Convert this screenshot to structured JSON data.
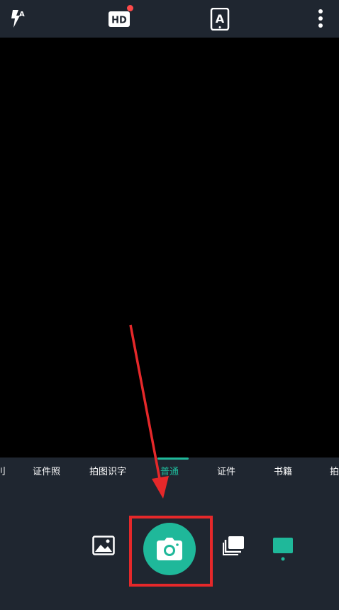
{
  "toolbar": {
    "icons": [
      "flash-auto-icon",
      "hd-icon",
      "text-recognition-icon",
      "more-icon"
    ],
    "hd_label": "HD",
    "ocr_label": "A",
    "flash_label": "A"
  },
  "modes": {
    "items": [
      "刂",
      "证件照",
      "拍图识字",
      "普通",
      "证件",
      "书籍",
      "拍"
    ],
    "selected": "普通"
  },
  "colors": {
    "accent": "#1fb89a",
    "annotation_red": "#e5282a",
    "badge_red": "#ff4a4a",
    "background": "#1f2630"
  },
  "controls": {
    "icons": [
      "gallery-icon",
      "camera-icon",
      "multi-page-icon",
      "tablet-icon"
    ]
  }
}
